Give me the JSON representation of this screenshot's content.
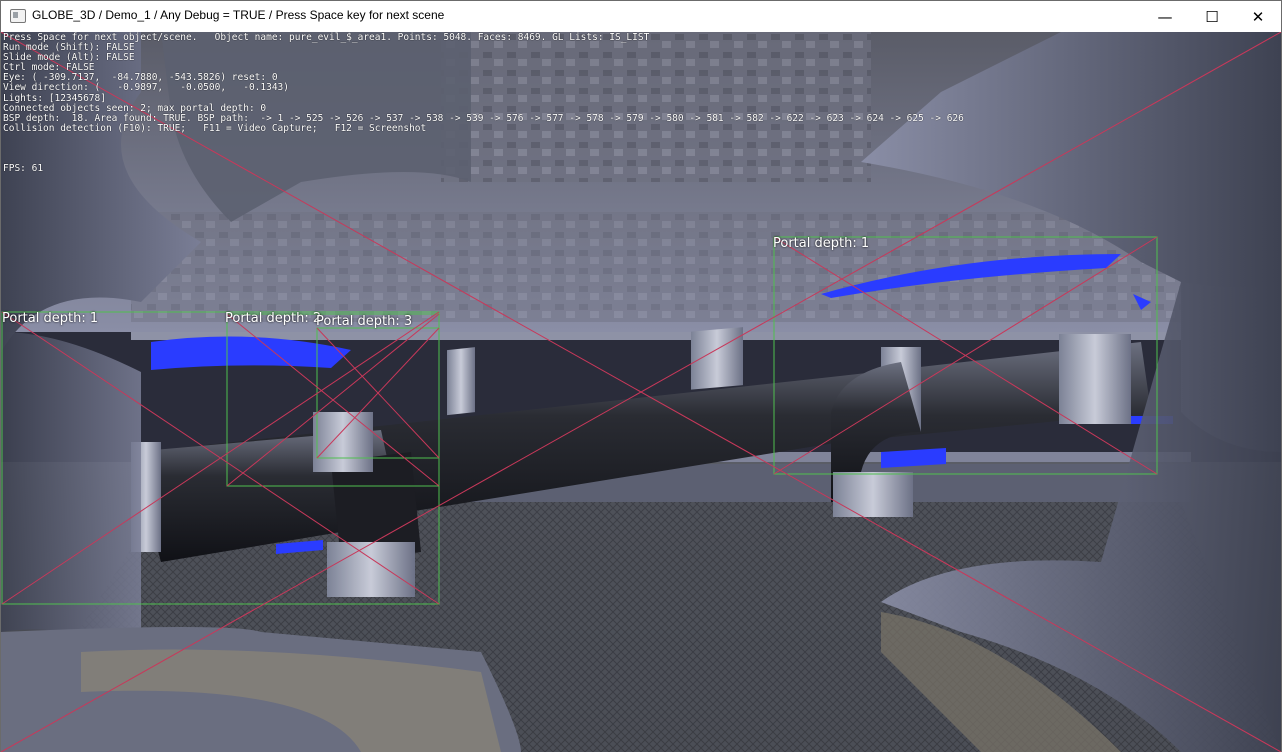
{
  "window": {
    "title": "GLOBE_3D / Demo_1 / Any Debug = TRUE / Press Space key for next scene",
    "icons": {
      "app": "app-window-icon",
      "minimize": "minimize-icon",
      "maximize": "maximize-icon",
      "close": "close-icon"
    },
    "minimize_glyph": "—",
    "maximize_glyph": "☐",
    "close_glyph": "✕"
  },
  "hud": {
    "lines": [
      "Press Space for next object/scene.   Object name: pure_evil_$_area1. Points: 5048. Faces: 8469. GL Lists: IS_LIST",
      "Run mode (Shift): FALSE",
      "Slide mode (Alt): FALSE",
      "Ctrl mode: FALSE",
      "Eye: ( -309.7137,  -84.7880, -543.5826) reset: 0",
      "View direction: (   -0.9897,   -0.0500,   -0.1343)",
      "Lights: [12345678]",
      "Connected objects seen: 2; max portal depth: 0",
      "BSP depth:  18. Area found: TRUE. BSP path:  -> 1 -> 525 -> 526 -> 537 -> 538 -> 539 -> 576 -> 577 -> 578 -> 579 -> 580 -> 581 -> 582 -> 622 -> 623 -> 624 -> 625 -> 626",
      "Collision detection (F10): TRUE;   F11 = Video Capture;   F12 = Screenshot"
    ],
    "fps": "FPS: 61"
  },
  "portals": [
    {
      "label": "Portal depth: 1"
    },
    {
      "label": "Portal depth: 2"
    },
    {
      "label": "Portal depth: 3"
    },
    {
      "label": "Portal depth: 1"
    }
  ],
  "colors": {
    "portal_frame": "#4fbf4f",
    "portal_diagonal": "#c8385a",
    "glow_blue": "#2a3cff",
    "floor": "#4b4e56",
    "wall": "#6a6e86"
  }
}
